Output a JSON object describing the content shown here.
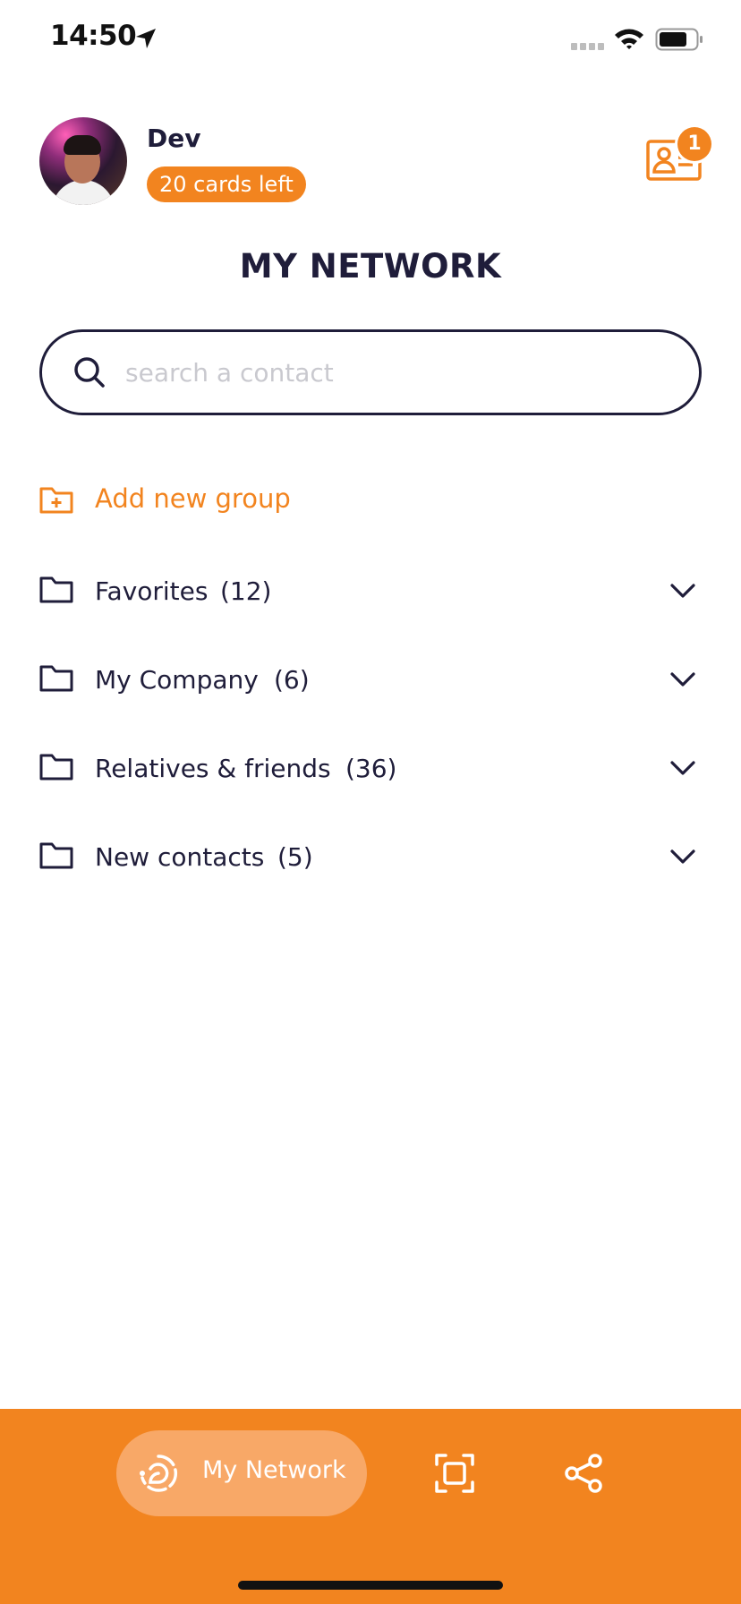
{
  "status_bar": {
    "time": "14:50",
    "icons": [
      "location-arrow-icon",
      "signal-icon",
      "wifi-icon",
      "battery-icon"
    ]
  },
  "header": {
    "user_name": "Dev",
    "cards_left": "20 cards left",
    "notification_count": "1",
    "avatar": "profile-photo"
  },
  "page_title": "MY NETWORK",
  "search": {
    "placeholder": "search a contact",
    "value": ""
  },
  "groups": {
    "add_label": "Add new group",
    "items": [
      {
        "name": "Favorites",
        "count": "(12)"
      },
      {
        "name": "My Company",
        "count": "(6)"
      },
      {
        "name": "Relatives & friends",
        "count": "(36)"
      },
      {
        "name": "New contacts",
        "count": "(5)"
      }
    ]
  },
  "tabbar": {
    "active_label": "My Network",
    "icons": [
      "my-network-icon",
      "scan-icon",
      "share-icon"
    ]
  },
  "colors": {
    "accent": "#f2841f",
    "accent_light": "#f8a867",
    "text_dark": "#1f1d3a",
    "placeholder": "#c9c9cf"
  }
}
